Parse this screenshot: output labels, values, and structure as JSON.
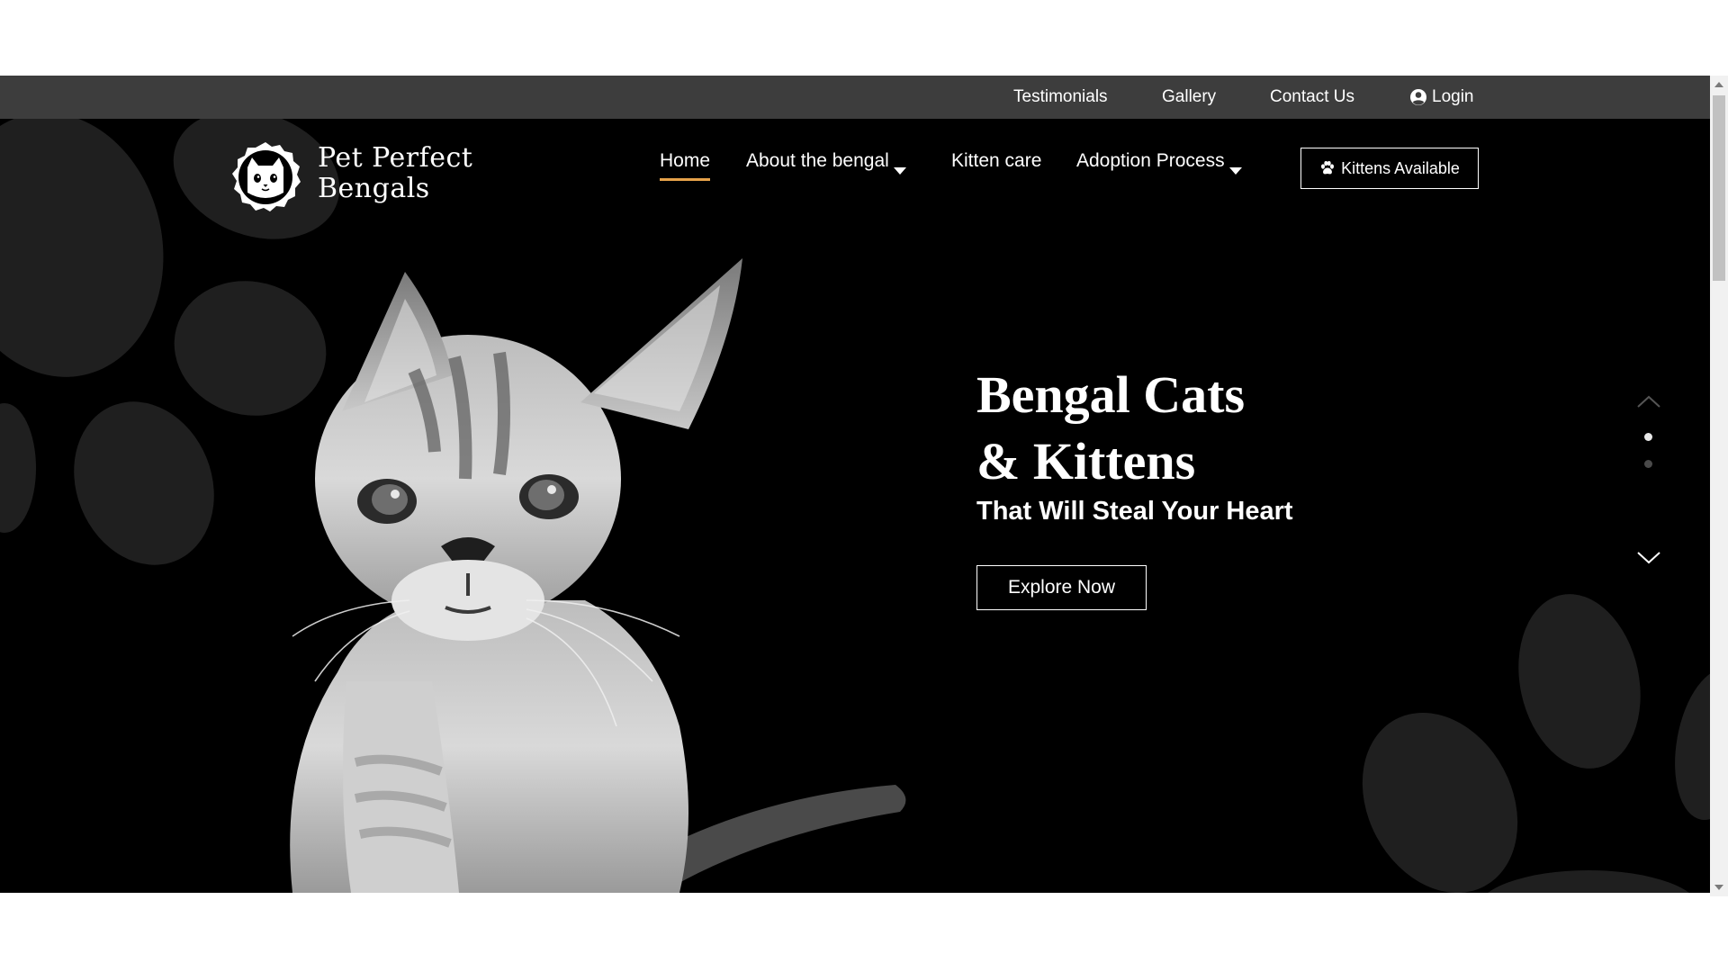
{
  "topbar": {
    "links": [
      "Testimonials",
      "Gallery",
      "Contact Us"
    ],
    "login_label": "Login",
    "bg_color": "#3d3d3d"
  },
  "logo": {
    "line1": "Pet Perfect",
    "line2": "Bengals",
    "icon": "cat-face-icon"
  },
  "nav": {
    "home": "Home",
    "about": "About the bengal",
    "kitten_care": "Kitten care",
    "adoption": "Adoption Process",
    "active_underline_color": "#e6a24a"
  },
  "kittens_button": {
    "label": "Kittens Available",
    "icon": "paw-icon"
  },
  "hero": {
    "title_line1": "Bengal Cats",
    "title_line2": "& Kittens",
    "subtitle": "That Will Steal Your Heart",
    "cta_label": "Explore Now",
    "image": "kitten-photo",
    "slides_total": 2,
    "active_slide": 1
  }
}
